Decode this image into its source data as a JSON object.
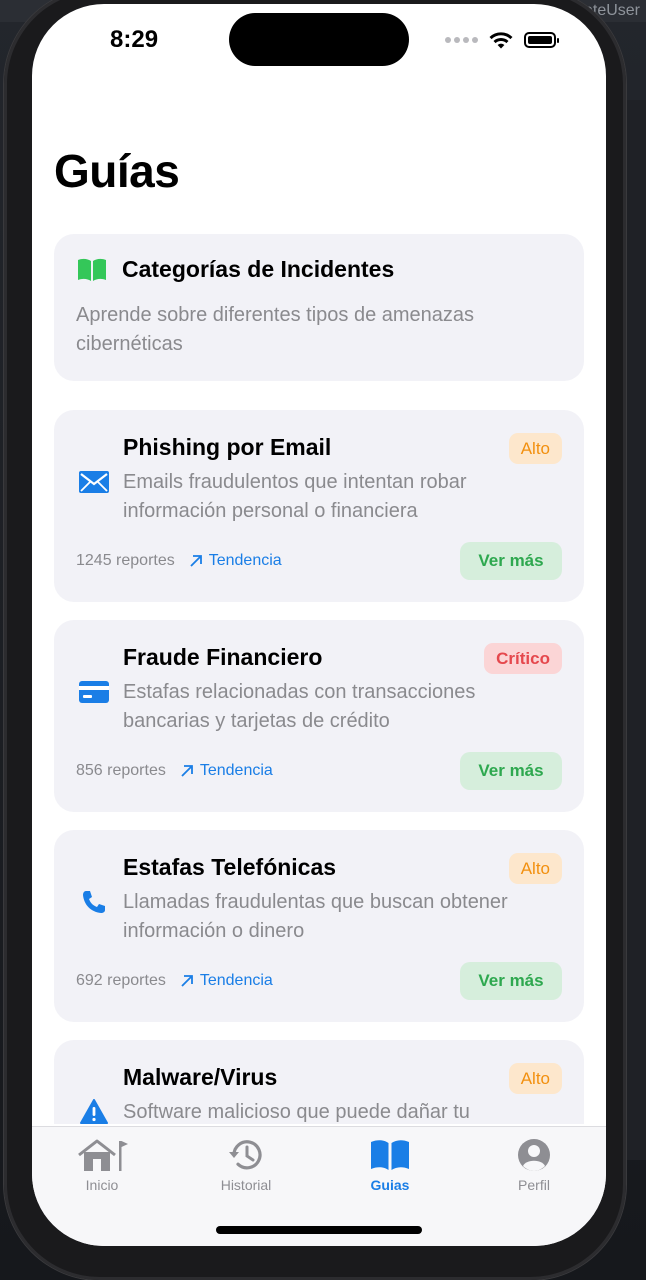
{
  "status": {
    "time": "8:29"
  },
  "header": {
    "title": "Guías"
  },
  "intro": {
    "title": "Categorías de Incidentes",
    "description": "Aprende sobre diferentes tipos de amenazas cibernéticas",
    "icon": "book-icon"
  },
  "incidents": [
    {
      "title": "Phishing por Email",
      "description": "Emails fraudulentos que intentan robar información personal o financiera",
      "severity": "Alto",
      "reports": "1245 reportes",
      "trend": "Tendencia",
      "action": "Ver más",
      "icon": "envelope-icon"
    },
    {
      "title": "Fraude Financiero",
      "description": "Estafas relacionadas con transacciones bancarias y tarjetas de crédito",
      "severity": "Crítico",
      "reports": "856 reportes",
      "trend": "Tendencia",
      "action": "Ver más",
      "icon": "credit-card-icon"
    },
    {
      "title": "Estafas Telefónicas",
      "description": "Llamadas fraudulentas que buscan obtener información o dinero",
      "severity": "Alto",
      "reports": "692 reportes",
      "trend": "Tendencia",
      "action": "Ver más",
      "icon": "phone-icon"
    },
    {
      "title": "Malware/Virus",
      "description": "Software malicioso que puede dañar tu",
      "severity": "Alto",
      "icon": "warning-icon"
    }
  ],
  "tabs": [
    {
      "label": "Inicio",
      "icon": "home-icon"
    },
    {
      "label": "Historial",
      "icon": "history-icon"
    },
    {
      "label": "Guias",
      "icon": "book-icon"
    },
    {
      "label": "Perfil",
      "icon": "profile-icon"
    }
  ],
  "colors": {
    "accent_blue": "#1a7ee6",
    "accent_green": "#2ea84f",
    "severity_alto": "#f2900f",
    "severity_critico": "#e5484d",
    "card_bg": "#f2f2f7"
  },
  "background": {
    "window_title_fragment": "eteUser"
  }
}
